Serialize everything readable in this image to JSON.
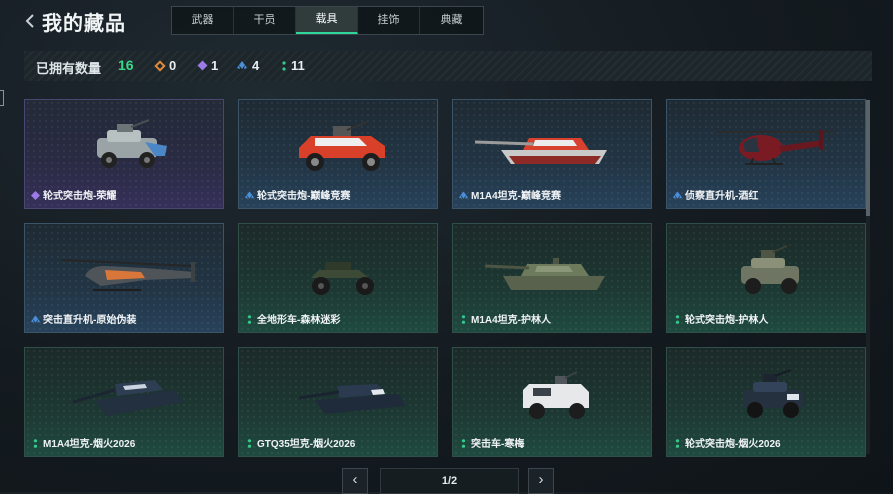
{
  "header": {
    "title": "我的藏品",
    "tabs": [
      {
        "label": "武器",
        "active": false
      },
      {
        "label": "干员",
        "active": false
      },
      {
        "label": "载具",
        "active": true
      },
      {
        "label": "挂饰",
        "active": false
      },
      {
        "label": "典藏",
        "active": false
      }
    ]
  },
  "stats": {
    "label": "已拥有数量",
    "total": "16",
    "counts": [
      {
        "rarity": "orange",
        "color": "#e08a3c",
        "value": "0"
      },
      {
        "rarity": "purple",
        "color": "#9c7ae8",
        "value": "1"
      },
      {
        "rarity": "blue",
        "color": "#4a8fd8",
        "value": "4"
      },
      {
        "rarity": "green",
        "color": "#33c98a",
        "value": "11"
      }
    ]
  },
  "items": [
    {
      "name": "轮式突击炮-荣耀",
      "rarity": "purple",
      "vehicle": "armored-car"
    },
    {
      "name": "轮式突击炮-巅峰竞赛",
      "rarity": "blue",
      "vehicle": "buggy"
    },
    {
      "name": "M1A4坦克-巅峰竞赛",
      "rarity": "blue",
      "vehicle": "tank"
    },
    {
      "name": "侦察直升机-酒红",
      "rarity": "blue",
      "vehicle": "helicopter"
    },
    {
      "name": "突击直升机-原始伪装",
      "rarity": "blue",
      "vehicle": "attack-helicopter"
    },
    {
      "name": "全地形车-森林迷彩",
      "rarity": "green",
      "vehicle": "atv"
    },
    {
      "name": "M1A4坦克-护林人",
      "rarity": "green",
      "vehicle": "tank"
    },
    {
      "name": "轮式突击炮-护林人",
      "rarity": "green",
      "vehicle": "armored-car"
    },
    {
      "name": "M1A4坦克-烟火2026",
      "rarity": "green",
      "vehicle": "tank"
    },
    {
      "name": "GTQ35坦克-烟火2026",
      "rarity": "green",
      "vehicle": "tank"
    },
    {
      "name": "突击车-寒梅",
      "rarity": "green",
      "vehicle": "truck"
    },
    {
      "name": "轮式突击炮-烟火2026",
      "rarity": "green",
      "vehicle": "armored-car"
    }
  ],
  "pagination": {
    "page": "1/2",
    "prev": "‹",
    "next": "›"
  },
  "icons": {
    "back": "chevron-left-icon",
    "prev": "chevron-left-icon",
    "next": "chevron-right-icon"
  }
}
